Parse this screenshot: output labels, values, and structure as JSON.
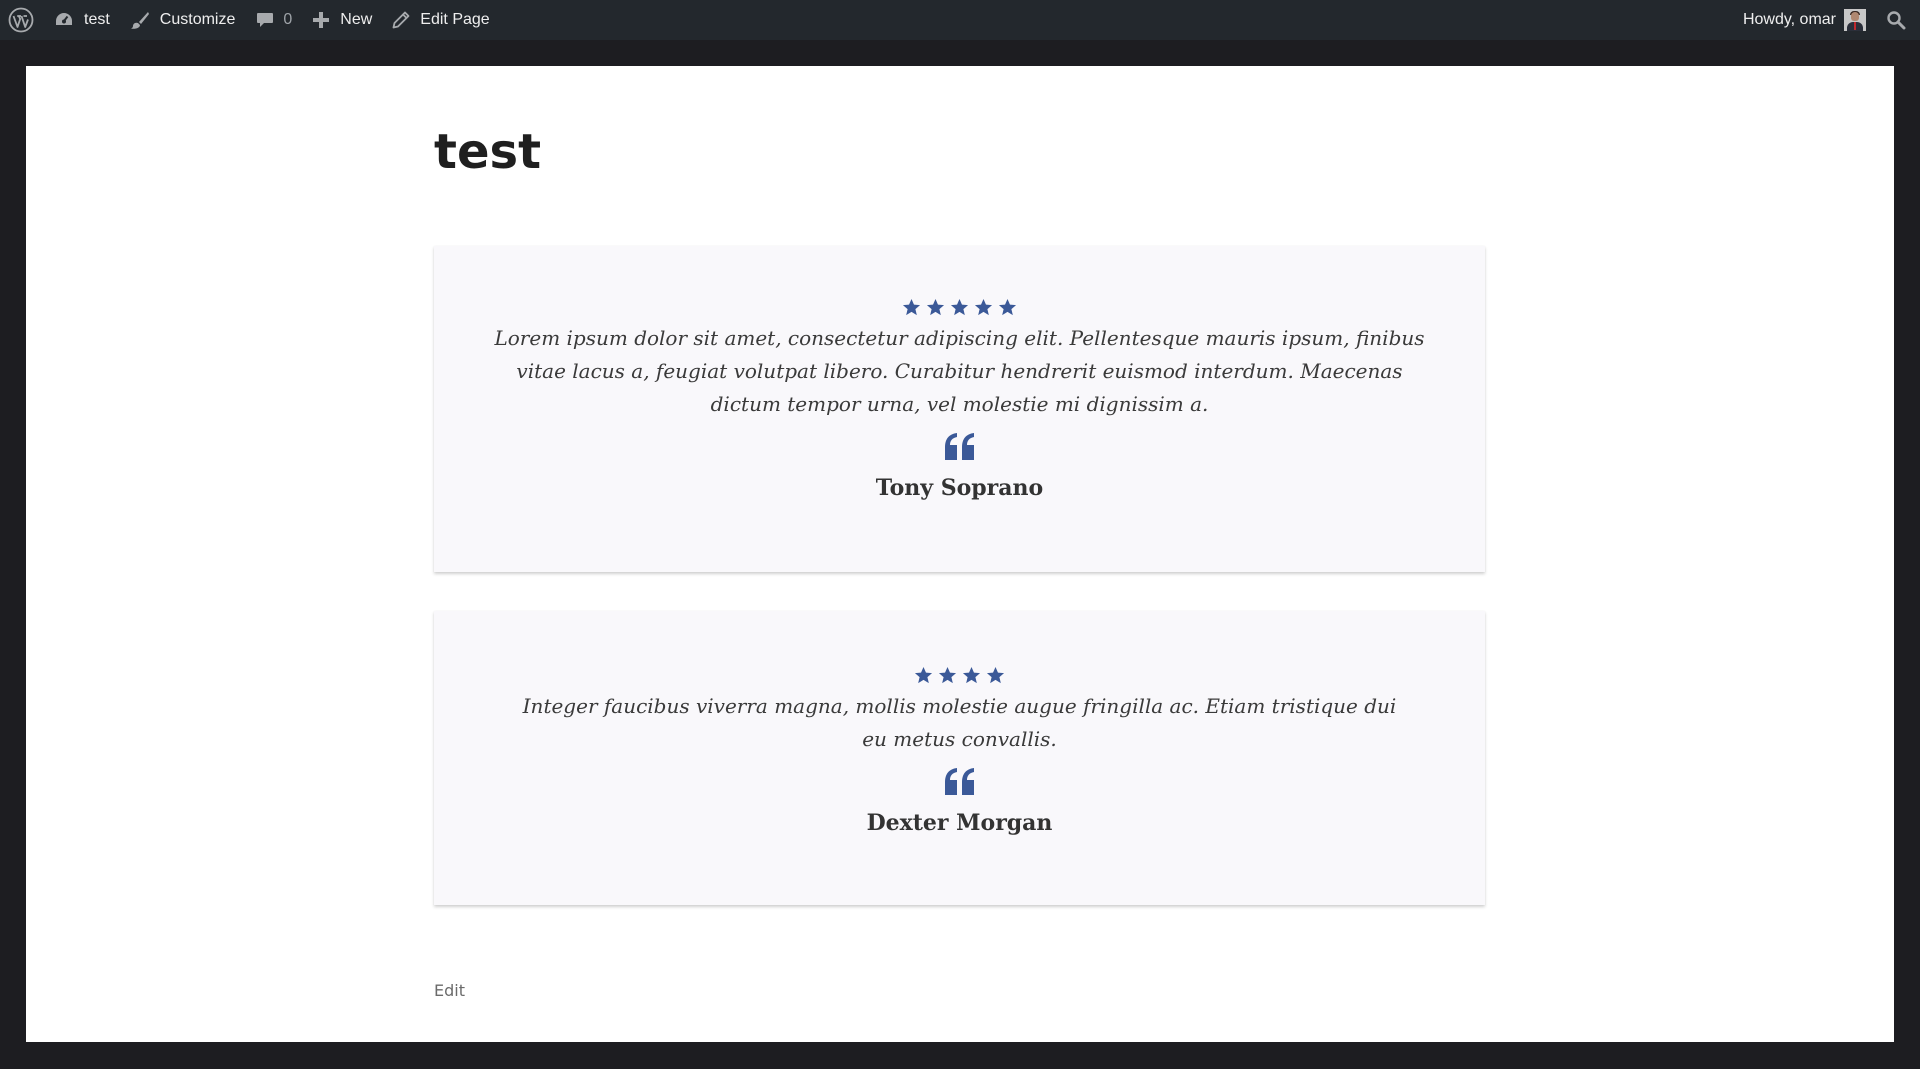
{
  "adminbar": {
    "site_name": "test",
    "customize_label": "Customize",
    "comments_count": "0",
    "new_label": "New",
    "edit_page_label": "Edit Page",
    "greeting": "Howdy, omar",
    "icons": [
      "wordpress-logo",
      "dashboard-icon",
      "brush-icon",
      "comment-icon",
      "plus-icon",
      "pencil-icon",
      "avatar",
      "search-icon"
    ]
  },
  "page": {
    "title": "test",
    "edit_label": "Edit"
  },
  "testimonials": [
    {
      "rating": 5,
      "text": "Lorem ipsum dolor sit amet, consectetur adipiscing elit. Pellentesque mauris ipsum, finibus vitae lacus a, feugiat volutpat libero. Curabitur hendrerit euismod interdum. Maecenas dictum tempor urna, vel molestie mi dignissim a.",
      "author": "Tony Soprano"
    },
    {
      "rating": 4,
      "text": "Integer faucibus viverra magna, mollis molestie augue fringilla ac. Etiam tristique dui eu metus convallis.",
      "author": "Dexter Morgan"
    }
  ],
  "colors": {
    "adminbar_bg": "#23282d",
    "frame_bg": "#1d1d21",
    "card_bg": "#f9f8fb",
    "accent_star_quote": "#3b5998"
  }
}
